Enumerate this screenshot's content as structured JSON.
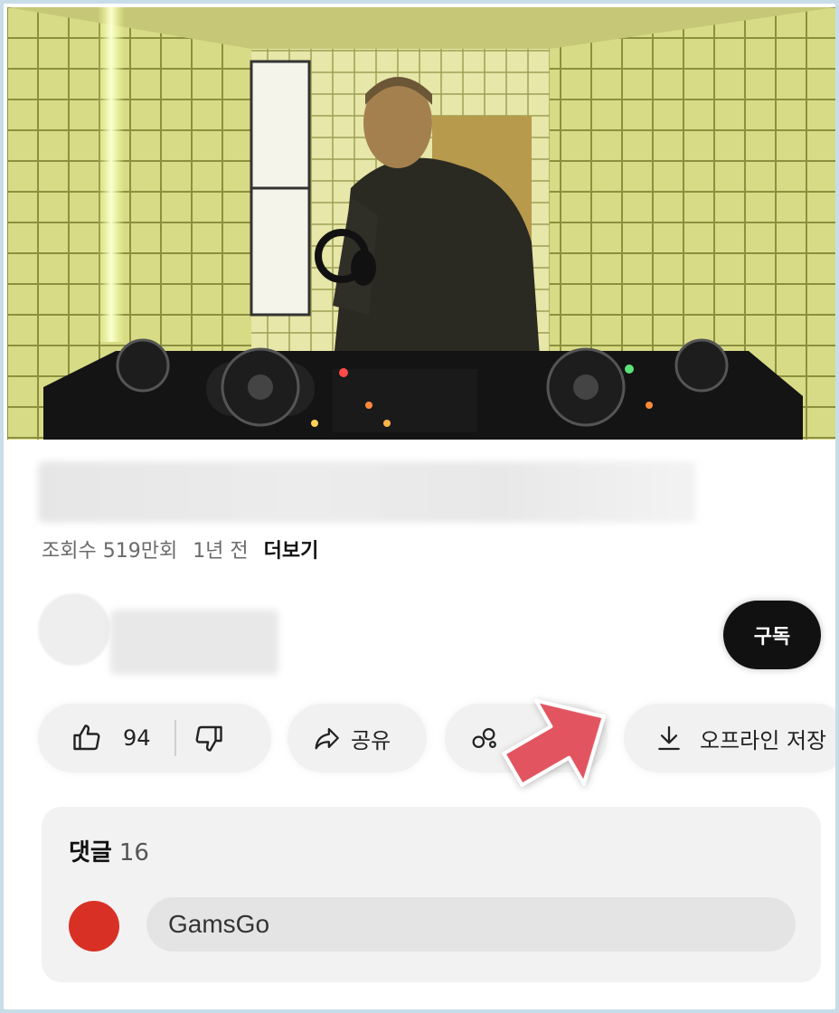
{
  "video": {
    "thumbnail": "dj-booth-tiled-room"
  },
  "meta": {
    "views": "조회수 519만회",
    "age": "1년 전",
    "more_label": "더보기"
  },
  "channel": {
    "subscribe_label": "구독"
  },
  "actions": {
    "like_count": "94",
    "share_label": "공유",
    "download_label": "오프라인 저장"
  },
  "comments": {
    "title": "댓글",
    "count": "16",
    "input_text": "GamsGo"
  },
  "icons": [
    "thumbs-up-icon",
    "thumbs-down-icon",
    "share-icon",
    "remix-icon",
    "download-icon"
  ],
  "colors": {
    "accent_arrow": "#e25560",
    "subscribe_bg": "#111111",
    "comment_avatar": "#d93025"
  }
}
